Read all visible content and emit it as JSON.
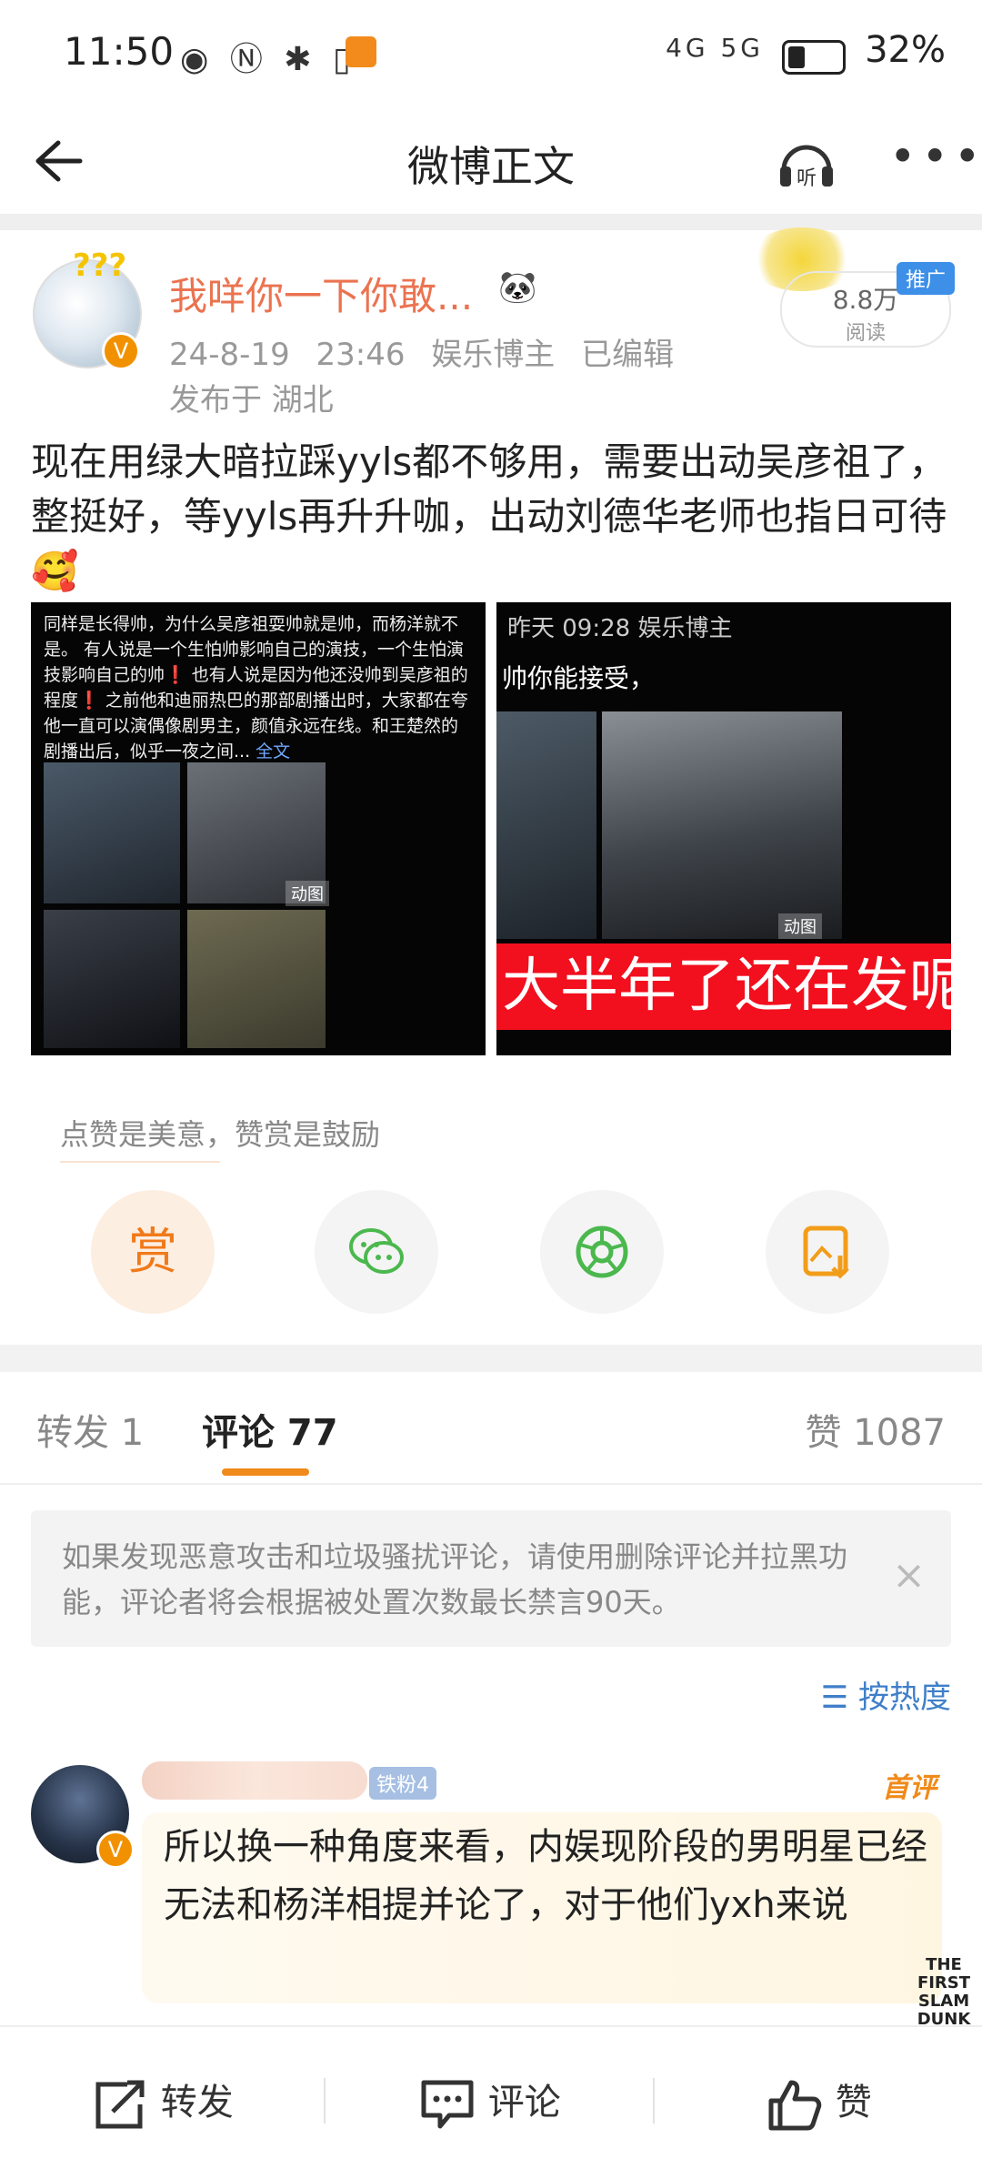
{
  "status_bar": {
    "time": "11:50",
    "left_icons": "◉ Ⓝ ✱ ▯",
    "network": "4G 5G",
    "battery": "32%"
  },
  "nav": {
    "title": "微博正文"
  },
  "author": {
    "name": "我咩你一下你敢...",
    "badges": "🐼",
    "date": "24-8-19 23:46",
    "role": "娱乐博主",
    "edited": "已编辑",
    "location": "发布于 湖北",
    "reads": "8.8万",
    "reads_label": "阅读",
    "promo": "推广"
  },
  "post": {
    "text": "现在用绿大暗拉踩yyls都不够用，需要出动吴彦祖了，整挺好，等yyls再升升咖，出动刘德华老师也指日可待🥰",
    "image1_caption": "同样是长得帅，为什么吴彦祖耍帅就是帅，而杨洋就不是。 有人说是一个生怕帅影响自己的演技，一个生怕演技影响自己的帅❗ 也有人说是因为他还没帅到吴彦祖的程度❗ 之前他和迪丽热巴的那部剧播出时，大家都在夸他一直可以演偶像剧男主，颜值永远在线。和王楚然的剧播出后，似乎一夜之间...",
    "image1_more": "全文",
    "image_tag": "动图",
    "image2_header": "昨天 09:28 娱乐博主",
    "image2_sub": "帅你能接受，",
    "image2_banner": "大半年了还在发呢"
  },
  "reward": {
    "hint": "点赞是美意，赞赏是鼓励",
    "reward_label": "赏"
  },
  "tabs": {
    "repost": "转发 1",
    "comment": "评论 77",
    "like": "赞 1087"
  },
  "notice": {
    "text": "如果发现恶意攻击和垃圾骚扰评论，请使用删除评论并拉黑功能，评论者将会根据被处置次数最长禁言90天。",
    "close": "×"
  },
  "sort": {
    "label": "按热度"
  },
  "comment": {
    "fan_badge": "铁粉4",
    "first_badge": "首评",
    "text": "所以换一种角度来看，内娱现阶段的男明星已经无法和杨洋相提并论了，对于他们yxh来说",
    "sticker": "THE FIRST SLAM DUNK"
  },
  "bottom_bar": {
    "repost": "转发",
    "comment": "评论",
    "like": "赞"
  }
}
